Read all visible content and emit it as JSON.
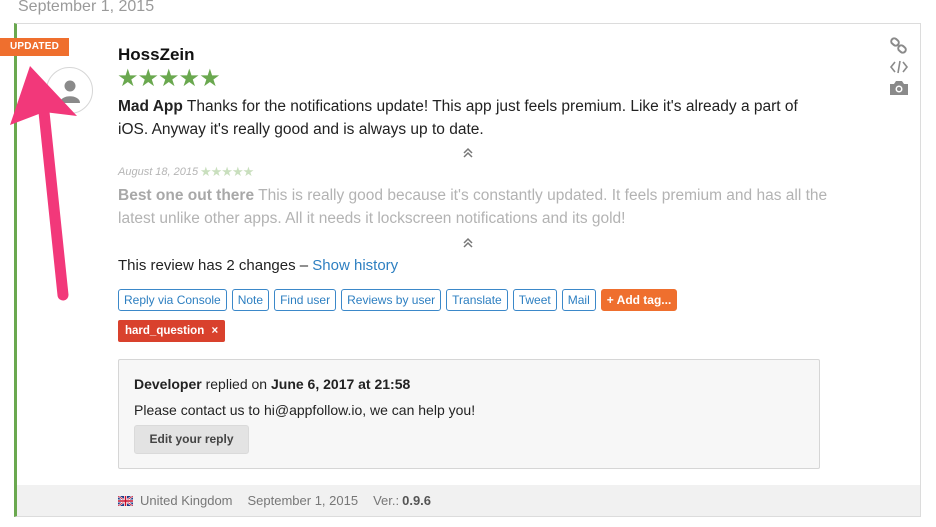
{
  "header": {
    "date": "September 1, 2015"
  },
  "review": {
    "badge": "UPDATED",
    "author": "HossZein",
    "stars": "★★★★★",
    "title": "Mad App",
    "text": "Thanks for the notifications update! This app just feels premium. Like it's already a part of iOS. Anyway it's really good and is always up to date."
  },
  "previous_version": {
    "date": "August 18, 2015",
    "stars": "★★★★★",
    "title": "Best one out there",
    "text": "This is really good because it's constantly updated. It feels premium and has all the latest unlike other apps. All it needs it lockscreen notifications and its gold!"
  },
  "changes": {
    "text": "This review has 2 changes –",
    "link": "Show history"
  },
  "actions": [
    "Reply via Console",
    "Note",
    "Find user",
    "Reviews by user",
    "Translate",
    "Tweet",
    "Mail",
    "+ Add tag..."
  ],
  "tag": {
    "label": "hard_question",
    "remove": "×"
  },
  "reply": {
    "author": "Developer",
    "replied_on": "replied on",
    "datetime": "June 6, 2017 at 21:58",
    "text": "Please contact us to hi@appfollow.io, we can help you!",
    "edit_label": "Edit your reply"
  },
  "footer": {
    "country": "United Kingdom",
    "date": "September 1, 2015",
    "version_label": "Ver.:",
    "version": "0.9.6"
  },
  "icons": [
    "link-icon",
    "code-icon",
    "camera-icon"
  ],
  "colors": {
    "accent_green": "#6aa84f",
    "orange": "#ef6f2e",
    "link_blue": "#2d7fc1",
    "tag_red": "#d9412d",
    "annotation_pink": "#f2387a"
  }
}
